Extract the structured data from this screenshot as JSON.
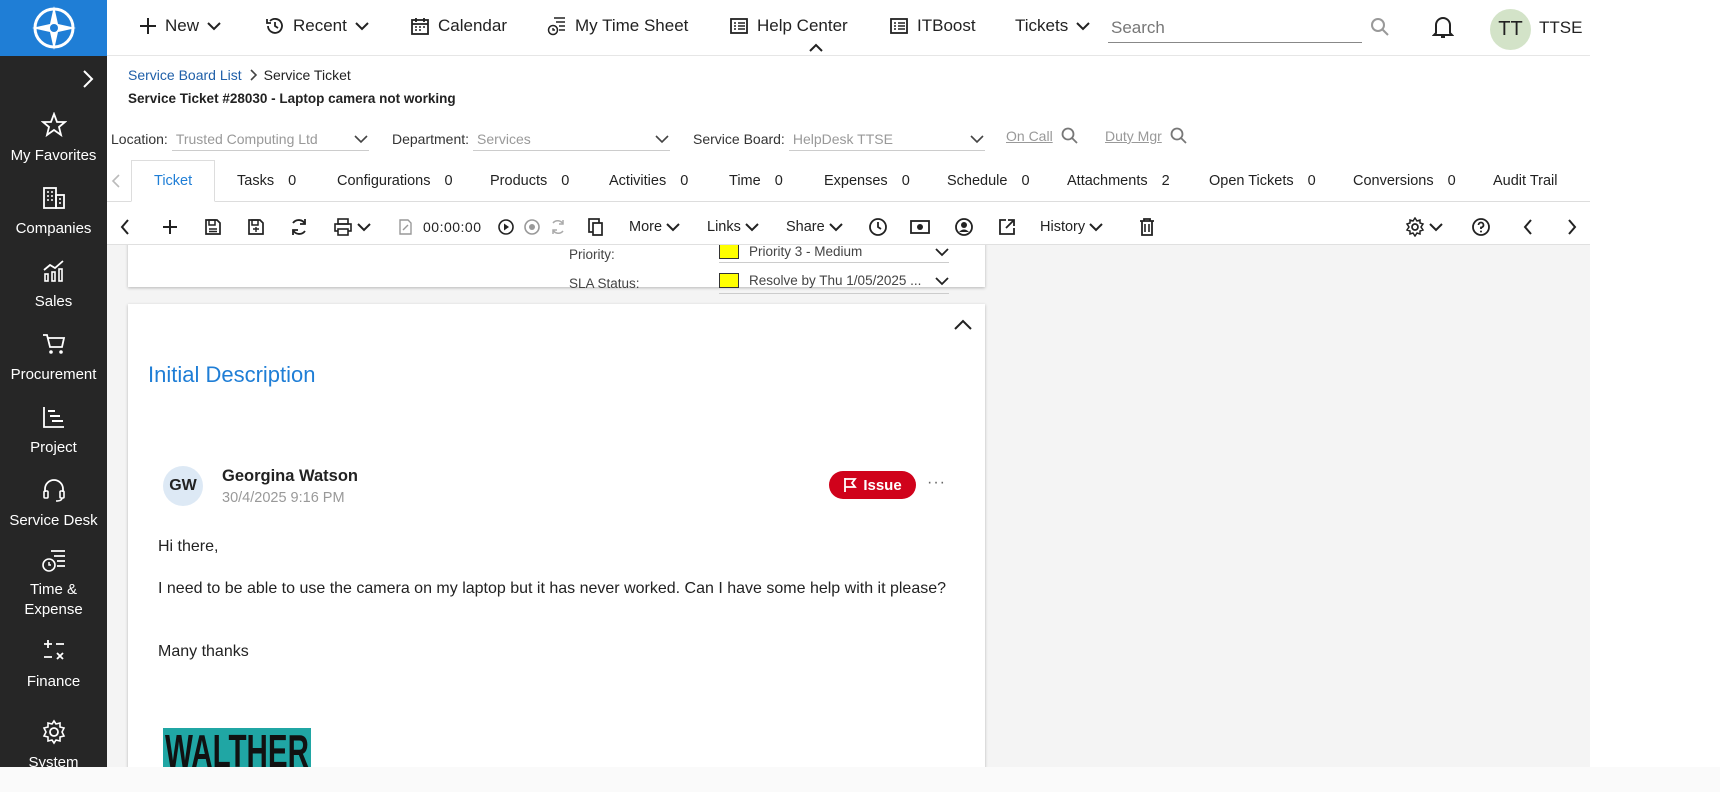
{
  "sidebar": {
    "items": [
      {
        "label": "My Favorites",
        "icon": "star-icon"
      },
      {
        "label": "Companies",
        "icon": "building-icon"
      },
      {
        "label": "Sales",
        "icon": "chart-icon"
      },
      {
        "label": "Procurement",
        "icon": "cart-icon"
      },
      {
        "label": "Project",
        "icon": "project-icon"
      },
      {
        "label": "Service Desk",
        "icon": "headset-icon"
      },
      {
        "label": "Time & Expense",
        "icon": "time-expense-icon"
      },
      {
        "label": "Finance",
        "icon": "calculator-icon"
      },
      {
        "label": "System",
        "icon": "gear-icon"
      }
    ]
  },
  "topbar": {
    "new": "New",
    "recent": "Recent",
    "calendar": "Calendar",
    "timesheet": "My Time Sheet",
    "help": "Help Center",
    "itboost": "ITBoost",
    "tickets": "Tickets",
    "search_placeholder": "Search",
    "avatar": "TT",
    "user": "TTSE"
  },
  "breadcrumb": {
    "parent": "Service Board List",
    "current": "Service Ticket"
  },
  "page_title": "Service Ticket #28030 - Laptop camera not working",
  "fields": {
    "location_label": "Location:",
    "location": "Trusted Computing Ltd",
    "department_label": "Department:",
    "department": "Services",
    "board_label": "Service Board:",
    "board": "HelpDesk TTSE",
    "on_call": "On Call",
    "duty_mgr": "Duty Mgr"
  },
  "tabs": [
    {
      "label": "Ticket",
      "count": ""
    },
    {
      "label": "Tasks",
      "count": "0"
    },
    {
      "label": "Configurations",
      "count": "0"
    },
    {
      "label": "Products",
      "count": "0"
    },
    {
      "label": "Activities",
      "count": "0"
    },
    {
      "label": "Time",
      "count": "0"
    },
    {
      "label": "Expenses",
      "count": "0"
    },
    {
      "label": "Schedule",
      "count": "0"
    },
    {
      "label": "Attachments",
      "count": "2"
    },
    {
      "label": "Open Tickets",
      "count": "0"
    },
    {
      "label": "Conversions",
      "count": "0"
    },
    {
      "label": "Audit Trail",
      "count": ""
    }
  ],
  "toolbar": {
    "timer": "00:00:00",
    "more": "More",
    "links": "Links",
    "share": "Share",
    "history": "History"
  },
  "ticket": {
    "priority_label": "Priority:",
    "priority": "Priority 3 - Medium",
    "sla_label": "SLA Status:",
    "sla": "Resolve by Thu 1/05/2025 ..."
  },
  "description": {
    "title": "Initial Description",
    "author_initials": "GW",
    "author": "Georgina Watson",
    "timestamp": "30/4/2025 9:16 PM",
    "badge": "Issue",
    "lines": [
      "Hi there,",
      "I need to be able to use the camera on my laptop but it has never worked.  Can I have some help with it please?",
      "Many thanks"
    ],
    "signature_text": "WALTHER STRONG"
  },
  "colors": {
    "accent": "#1f7ed6",
    "issue": "#d0021b",
    "sidebar": "#262626"
  }
}
